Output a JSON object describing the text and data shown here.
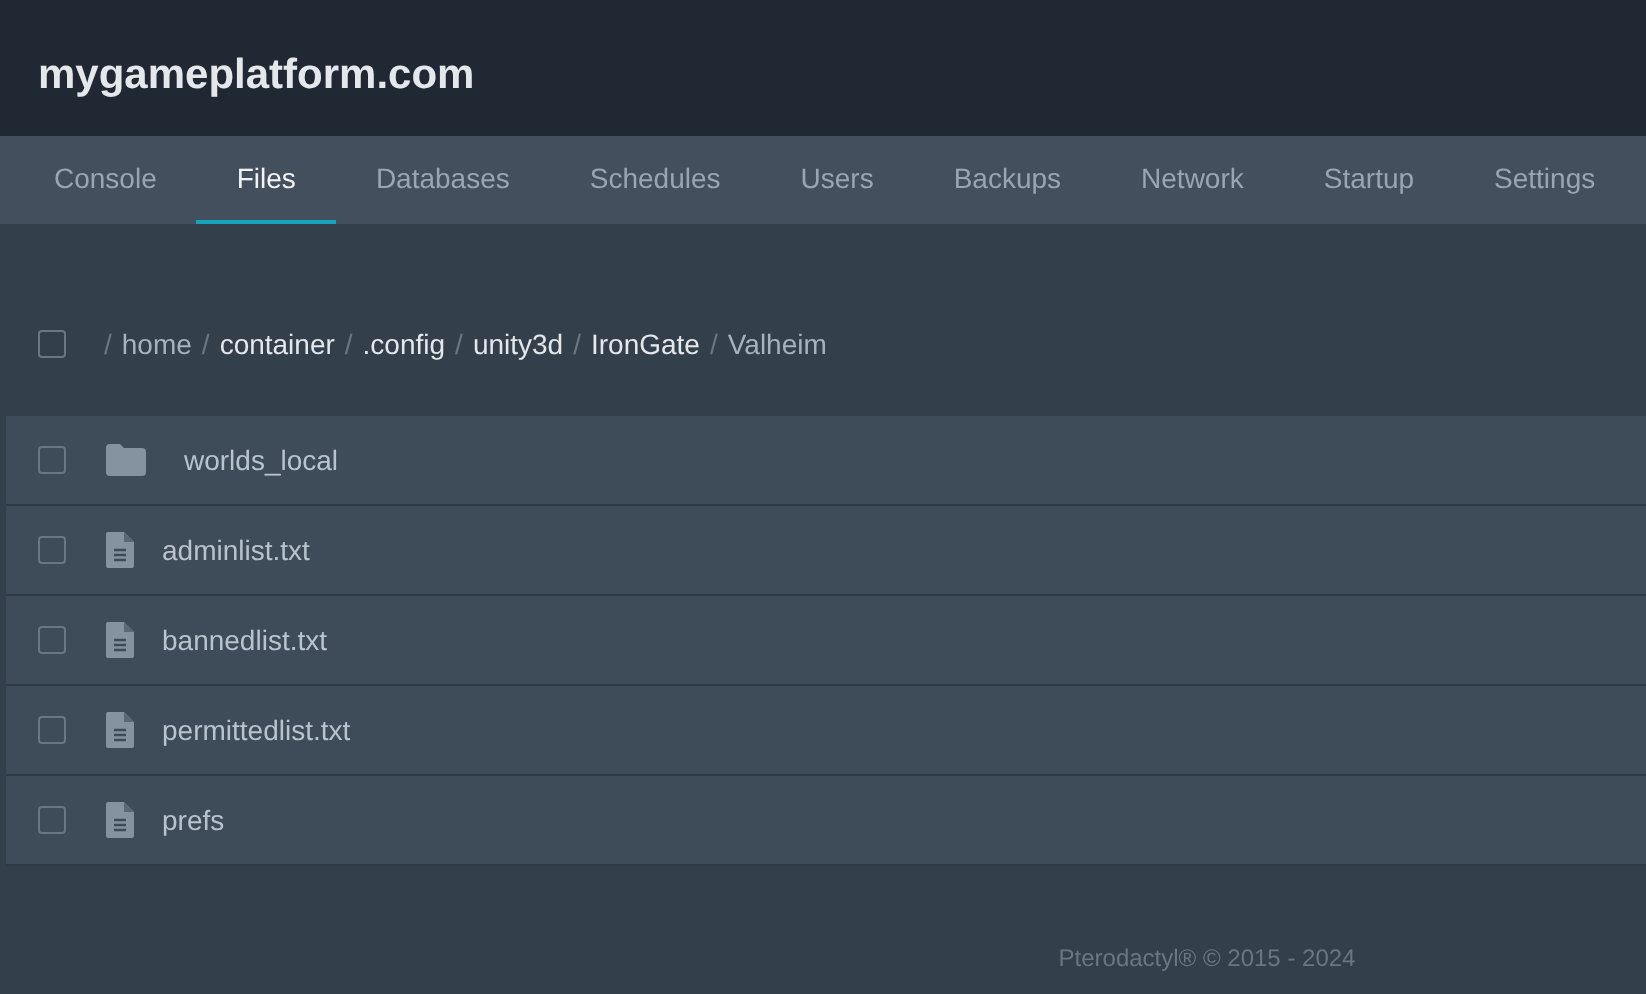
{
  "header": {
    "title": "mygameplatform.com"
  },
  "tabs": [
    {
      "label": "Console",
      "selected": false
    },
    {
      "label": "Files",
      "selected": true
    },
    {
      "label": "Databases",
      "selected": false
    },
    {
      "label": "Schedules",
      "selected": false
    },
    {
      "label": "Users",
      "selected": false
    },
    {
      "label": "Backups",
      "selected": false
    },
    {
      "label": "Network",
      "selected": false
    },
    {
      "label": "Startup",
      "selected": false
    },
    {
      "label": "Settings",
      "selected": false
    }
  ],
  "breadcrumb": {
    "select_all": {
      "checked": false
    },
    "separator": "/",
    "segments": [
      {
        "label": "home",
        "kind": "text"
      },
      {
        "label": "container",
        "kind": "link"
      },
      {
        "label": ".config",
        "kind": "link"
      },
      {
        "label": "unity3d",
        "kind": "link"
      },
      {
        "label": "IronGate",
        "kind": "link"
      },
      {
        "label": "Valheim",
        "kind": "text"
      }
    ]
  },
  "files": [
    {
      "name": "worlds_local",
      "kind": "folder",
      "checked": false
    },
    {
      "name": "adminlist.txt",
      "kind": "file",
      "checked": false
    },
    {
      "name": "bannedlist.txt",
      "kind": "file",
      "checked": false
    },
    {
      "name": "permittedlist.txt",
      "kind": "file",
      "checked": false
    },
    {
      "name": "prefs",
      "kind": "file",
      "checked": false
    }
  ],
  "footer": {
    "text": "Pterodactyl® © 2015 - 2024"
  }
}
